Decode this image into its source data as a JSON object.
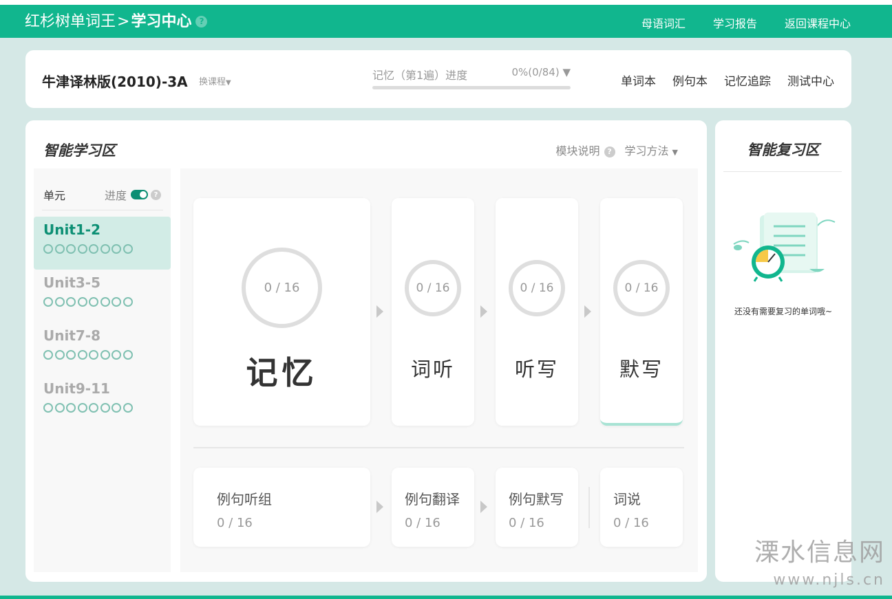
{
  "header": {
    "brand": "红杉树单词王",
    "separator": ">",
    "section": "学习中心",
    "help_glyph": "?",
    "nav": [
      "母语词汇",
      "学习报告",
      "返回课程中心"
    ]
  },
  "course": {
    "title": "牛津译林版(2010)-3A",
    "switch_label": "换课程",
    "progress_label": "记忆（第1遍）进度",
    "progress_value": "0%(0/84)",
    "progress_fraction": 0,
    "links": [
      "单词本",
      "例句本",
      "记忆追踪",
      "测试中心"
    ]
  },
  "study": {
    "title": "智能学习区",
    "module_help": "模块说明",
    "method": "学习方法",
    "units_header": "单元",
    "progress_toggle_label": "进度",
    "units": [
      {
        "name": "Unit1-2",
        "active": true
      },
      {
        "name": "Unit3-5",
        "active": false
      },
      {
        "name": "Unit7-8",
        "active": false
      },
      {
        "name": "Unit9-11",
        "active": false
      }
    ],
    "modules": [
      {
        "name": "记忆",
        "count": "0 / 16"
      },
      {
        "name": "词听",
        "count": "0 / 16"
      },
      {
        "name": "听写",
        "count": "0 / 16"
      },
      {
        "name": "默写",
        "count": "0 / 16"
      }
    ],
    "sentence_modules": [
      {
        "name": "例句听组",
        "count": "0 / 16"
      },
      {
        "name": "例句翻译",
        "count": "0 / 16"
      },
      {
        "name": "例句默写",
        "count": "0 / 16"
      },
      {
        "name": "词说",
        "count": "0 / 16"
      }
    ]
  },
  "review": {
    "title": "智能复习区",
    "empty_message": "还没有需要复习的单词哦~"
  },
  "watermark": {
    "name": "溧水信息网",
    "url": "www.njls.cn"
  },
  "colors": {
    "brand_green": "#11b68e",
    "dark_green": "#0c8f74",
    "active_unit_bg": "#d2ece6",
    "page_bg": "#d5e8e6"
  }
}
